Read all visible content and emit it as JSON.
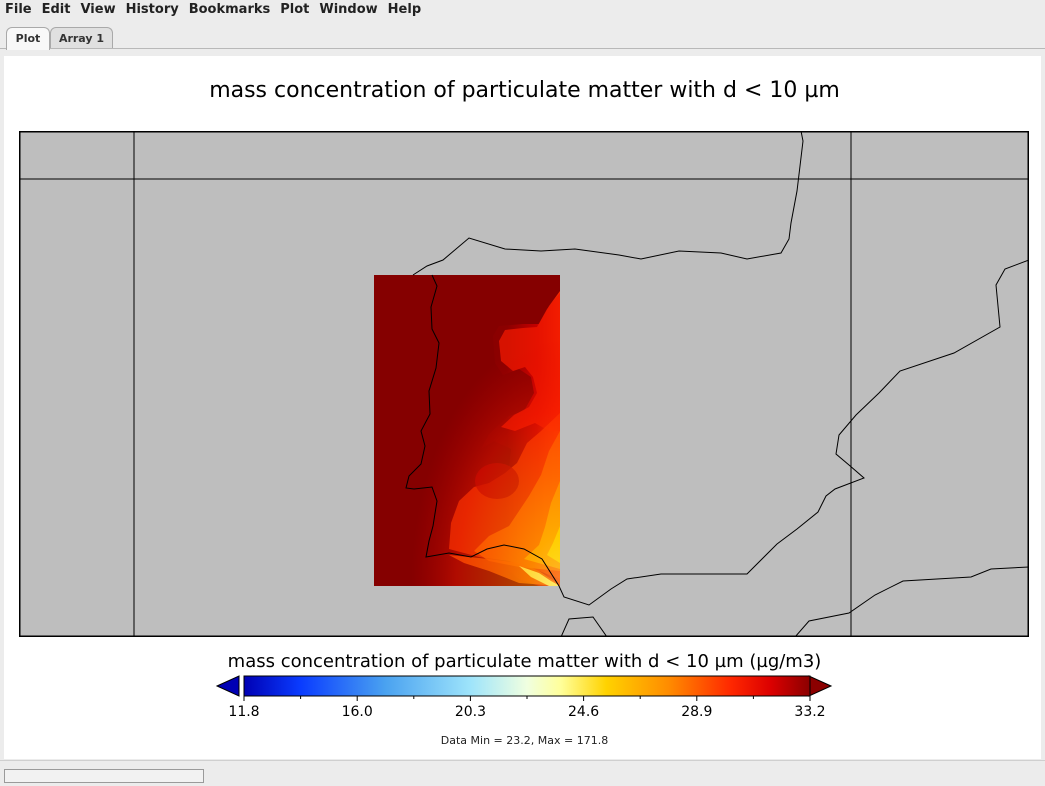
{
  "menu": [
    "File",
    "Edit",
    "View",
    "History",
    "Bookmarks",
    "Plot",
    "Window",
    "Help"
  ],
  "tabs": [
    {
      "label": "Plot",
      "active": true
    },
    {
      "label": "Array 1",
      "active": false
    }
  ],
  "plot": {
    "title": "mass concentration of particulate matter with d < 10 µm",
    "colorbar_title": "mass concentration of particulate matter with d < 10 µm (µg/m3)",
    "colorbar_ticks": [
      "11.8",
      "16.0",
      "20.3",
      "24.6",
      "28.9",
      "33.2"
    ],
    "data_minmax": "Data Min = 23.2, Max = 171.8"
  },
  "colors": {
    "map_background": "#bebebe",
    "coastline": "#000000",
    "colormap": [
      "#0000b4",
      "#0a3cff",
      "#4aa2f0",
      "#9ee4fb",
      "#ffff9a",
      "#ffd200",
      "#ff8c00",
      "#ff2800",
      "#dc0000",
      "#8b0000"
    ]
  }
}
